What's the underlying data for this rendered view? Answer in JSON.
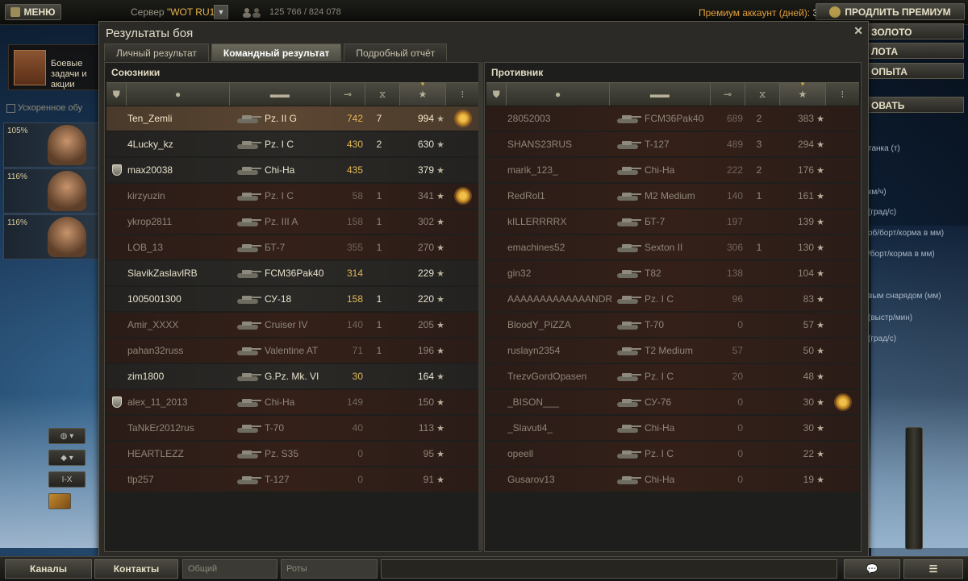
{
  "topbar": {
    "menu_label": "МЕНЮ",
    "server_prefix": "Сервер ",
    "server_name": "\"WOT RU1\"",
    "online_count": "125 766 / 824 078",
    "premium_text": "Премиум аккаунт (дней):",
    "premium_days": "30",
    "extend_premium_label": "ПРОДЛИТЬ ПРЕМИУМ"
  },
  "left_bg": {
    "mission_line1": "Боевые",
    "mission_line2": "задачи и акции",
    "crew_speedup": "Ускоренное обу",
    "crew": [
      {
        "pct": "105%"
      },
      {
        "pct": "116%"
      },
      {
        "pct": "116%"
      }
    ],
    "tier_filter": "I-X"
  },
  "right_bg": {
    "buttons": [
      "ЗОЛОТО",
      "ЛОТА",
      "ОПЫТА",
      "ОВАТЬ"
    ],
    "stats": [
      "танка (т)",
      "",
      "км/ч)",
      "(град/с)",
      "об/борт/корма в мм)",
      "/борт/корма в мм)",
      "",
      "вым снарядом (мм)",
      "(выстр/мин)",
      "(град/с)"
    ]
  },
  "modal": {
    "title": "Результаты боя",
    "tabs": [
      "Личный результат",
      "Командный результат",
      "Подробный отчёт"
    ],
    "allies_title": "Союзники",
    "enemies_title": "Противник"
  },
  "allies": [
    {
      "name": "Ten_Zemli",
      "vehicle": "Pz. II G",
      "damage": "742",
      "frags": "7",
      "xp": "994",
      "state": "me",
      "platoon": false,
      "medal": true
    },
    {
      "name": "4Lucky_kz",
      "vehicle": "Pz. I C",
      "damage": "430",
      "frags": "2",
      "xp": "630",
      "state": "alive",
      "platoon": false,
      "medal": false
    },
    {
      "name": "max20038",
      "vehicle": "Chi-Ha",
      "damage": "435",
      "frags": "",
      "xp": "379",
      "state": "alive",
      "platoon": true,
      "medal": false
    },
    {
      "name": "kirzyuzin",
      "vehicle": "Pz. I C",
      "damage": "58",
      "frags": "1",
      "xp": "341",
      "state": "dead",
      "platoon": false,
      "medal": true
    },
    {
      "name": "ykrop2811",
      "vehicle": "Pz. III A",
      "damage": "158",
      "frags": "1",
      "xp": "302",
      "state": "dead",
      "platoon": false,
      "medal": false
    },
    {
      "name": "LOB_13",
      "vehicle": "БТ-7",
      "damage": "355",
      "frags": "1",
      "xp": "270",
      "state": "dead",
      "platoon": false,
      "medal": false
    },
    {
      "name": "SlavikZaslavlRB",
      "vehicle": "FCM36Pak40",
      "damage": "314",
      "frags": "",
      "xp": "229",
      "state": "alive",
      "platoon": false,
      "medal": false
    },
    {
      "name": "1005001300",
      "vehicle": "СУ-18",
      "damage": "158",
      "frags": "1",
      "xp": "220",
      "state": "alive",
      "platoon": false,
      "medal": false
    },
    {
      "name": "Amir_XXXX",
      "vehicle": "Cruiser IV",
      "damage": "140",
      "frags": "1",
      "xp": "205",
      "state": "dead",
      "platoon": false,
      "medal": false
    },
    {
      "name": "pahan32russ",
      "vehicle": "Valentine AT",
      "damage": "71",
      "frags": "1",
      "xp": "196",
      "state": "dead",
      "platoon": false,
      "medal": false
    },
    {
      "name": "zim1800",
      "vehicle": "G.Pz. Mk. VI",
      "damage": "30",
      "frags": "",
      "xp": "164",
      "state": "alive",
      "platoon": false,
      "medal": false
    },
    {
      "name": "alex_11_2013",
      "vehicle": "Chi-Ha",
      "damage": "149",
      "frags": "",
      "xp": "150",
      "state": "dead",
      "platoon": true,
      "medal": false
    },
    {
      "name": "TaNkEr2012rus",
      "vehicle": "T-70",
      "damage": "40",
      "frags": "",
      "xp": "113",
      "state": "dead",
      "platoon": false,
      "medal": false
    },
    {
      "name": "HEARTLEZZ",
      "vehicle": "Pz. S35",
      "damage": "0",
      "frags": "",
      "xp": "95",
      "state": "dead",
      "platoon": false,
      "medal": false
    },
    {
      "name": "tlp257",
      "vehicle": "T-127",
      "damage": "0",
      "frags": "",
      "xp": "91",
      "state": "dead",
      "platoon": false,
      "medal": false
    }
  ],
  "enemies": [
    {
      "name": "28052003",
      "vehicle": "FCM36Pak40",
      "damage": "689",
      "frags": "2",
      "xp": "383",
      "state": "dead",
      "platoon": false,
      "medal": false
    },
    {
      "name": "SHANS23RUS",
      "vehicle": "T-127",
      "damage": "489",
      "frags": "3",
      "xp": "294",
      "state": "dead",
      "platoon": false,
      "medal": false
    },
    {
      "name": "marik_123_",
      "vehicle": "Chi-Ha",
      "damage": "222",
      "frags": "2",
      "xp": "176",
      "state": "dead",
      "platoon": false,
      "medal": false
    },
    {
      "name": "RedRol1",
      "vehicle": "M2 Medium",
      "damage": "140",
      "frags": "1",
      "xp": "161",
      "state": "dead",
      "platoon": false,
      "medal": false
    },
    {
      "name": "kILLERRRRX",
      "vehicle": "БТ-7",
      "damage": "197",
      "frags": "",
      "xp": "139",
      "state": "dead",
      "platoon": false,
      "medal": false
    },
    {
      "name": "emachines52",
      "vehicle": "Sexton II",
      "damage": "306",
      "frags": "1",
      "xp": "130",
      "state": "dead",
      "platoon": false,
      "medal": false
    },
    {
      "name": "gin32",
      "vehicle": "T82",
      "damage": "138",
      "frags": "",
      "xp": "104",
      "state": "dead",
      "platoon": false,
      "medal": false
    },
    {
      "name": "AAAAAAAAAAAAANDREY",
      "vehicle": "Pz. I C",
      "damage": "96",
      "frags": "",
      "xp": "83",
      "state": "dead",
      "platoon": false,
      "medal": false
    },
    {
      "name": "BloodY_PiZZA",
      "vehicle": "T-70",
      "damage": "0",
      "frags": "",
      "xp": "57",
      "state": "dead",
      "platoon": false,
      "medal": false
    },
    {
      "name": "ruslayn2354",
      "vehicle": "T2 Medium",
      "damage": "57",
      "frags": "",
      "xp": "50",
      "state": "dead",
      "platoon": false,
      "medal": false
    },
    {
      "name": "TrezvGordOpasen",
      "vehicle": "Pz. I C",
      "damage": "20",
      "frags": "",
      "xp": "48",
      "state": "dead",
      "platoon": false,
      "medal": false
    },
    {
      "name": "_BISON___",
      "vehicle": "СУ-76",
      "damage": "0",
      "frags": "",
      "xp": "30",
      "state": "dead",
      "platoon": false,
      "medal": true
    },
    {
      "name": "_Slavuti4_",
      "vehicle": "Chi-Ha",
      "damage": "0",
      "frags": "",
      "xp": "30",
      "state": "dead",
      "platoon": false,
      "medal": false
    },
    {
      "name": "opeell",
      "vehicle": "Pz. I C",
      "damage": "0",
      "frags": "",
      "xp": "22",
      "state": "dead",
      "platoon": false,
      "medal": false
    },
    {
      "name": "Gusarov13",
      "vehicle": "Chi-Ha",
      "damage": "0",
      "frags": "",
      "xp": "19",
      "state": "dead",
      "platoon": false,
      "medal": false
    }
  ],
  "bottombar": {
    "channels_label": "Каналы",
    "contacts_label": "Контакты",
    "common_label": "Общий",
    "companies_label": "Роты"
  }
}
